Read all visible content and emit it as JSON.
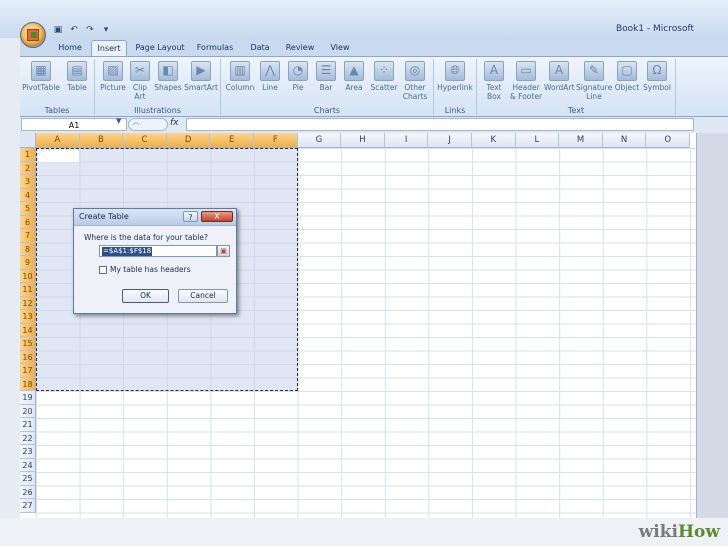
{
  "window": {
    "title": "Book1 - Microsoft"
  },
  "quick_access": [
    "save-icon",
    "undo-icon",
    "redo-icon",
    "customize-icon"
  ],
  "tabs": [
    {
      "label": "Home",
      "active": false
    },
    {
      "label": "Insert",
      "active": true
    },
    {
      "label": "Page Layout",
      "active": false
    },
    {
      "label": "Formulas",
      "active": false
    },
    {
      "label": "Data",
      "active": false
    },
    {
      "label": "Review",
      "active": false
    },
    {
      "label": "View",
      "active": false
    }
  ],
  "ribbon": {
    "groups": [
      {
        "label": "Tables",
        "buttons": [
          "PivotTable",
          "Table"
        ]
      },
      {
        "label": "Illustrations",
        "buttons": [
          "Picture",
          "Clip Art",
          "Shapes",
          "SmartArt"
        ]
      },
      {
        "label": "Charts",
        "buttons": [
          "Column",
          "Line",
          "Pie",
          "Bar",
          "Area",
          "Scatter",
          "Other Charts"
        ]
      },
      {
        "label": "Links",
        "buttons": [
          "Hyperlink"
        ]
      },
      {
        "label": "Text",
        "buttons": [
          "Text Box",
          "Header & Footer",
          "WordArt",
          "Signature Line",
          "Object",
          "Symbol"
        ]
      }
    ]
  },
  "formula_bar": {
    "name_box": "A1",
    "fx": "fx"
  },
  "columns": [
    "A",
    "B",
    "C",
    "D",
    "E",
    "F",
    "G",
    "H",
    "I",
    "J",
    "K",
    "L",
    "M",
    "N",
    "O"
  ],
  "selected_columns": [
    "A",
    "B",
    "C",
    "D",
    "E",
    "F"
  ],
  "rows": [
    "1",
    "2",
    "3",
    "4",
    "5",
    "6",
    "7",
    "8",
    "9",
    "10",
    "11",
    "12",
    "13",
    "14",
    "15",
    "16",
    "17",
    "18",
    "19",
    "20",
    "21",
    "22",
    "23",
    "24",
    "25",
    "26",
    "27"
  ],
  "selected_row_count": 18,
  "dialog": {
    "title": "Create Table",
    "help": "?",
    "close": "X",
    "question": "Where is the data for your table?",
    "range": "=$A$1:$F$18",
    "checkbox_label": "My table has headers",
    "checkbox_checked": false,
    "ok": "OK",
    "cancel": "Cancel"
  },
  "watermark": {
    "wiki": "wiki",
    "how": "How"
  },
  "colors": {
    "accent": "#2e4f86",
    "selection_header": "#f2ae46",
    "ribbon_bg": "#d5e3f4"
  }
}
